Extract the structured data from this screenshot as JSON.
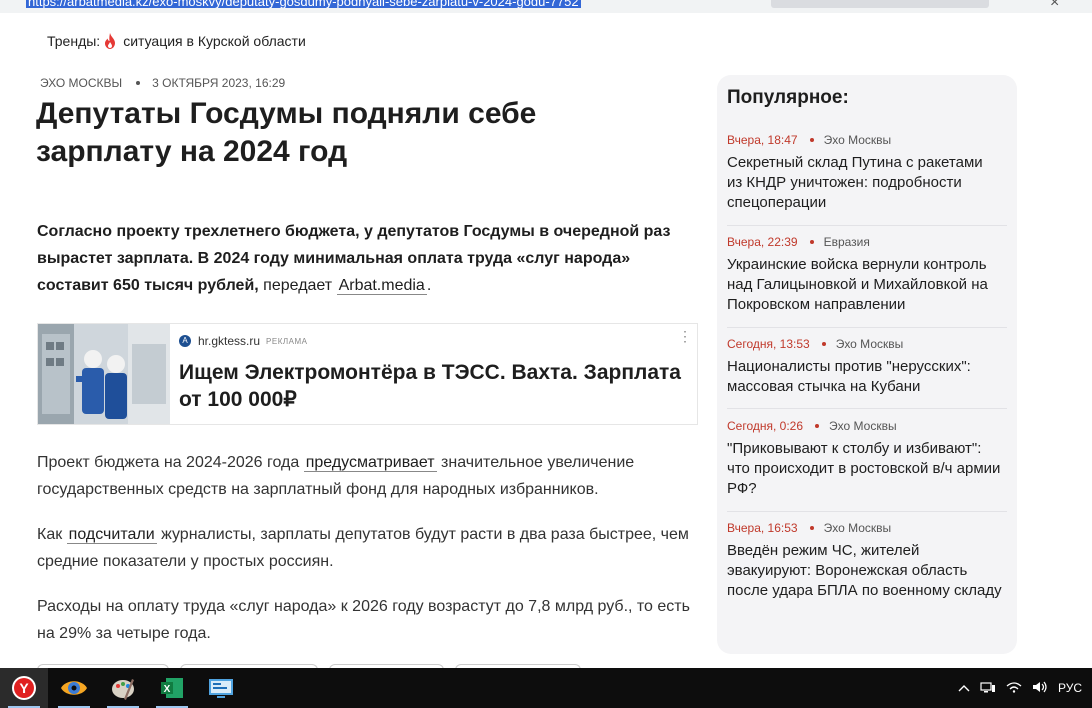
{
  "browser": {
    "url": "https://arbatmedia.kz/exo-moskvy/deputaty-gosdumy-podnyali-sebe-zarplatu-v-2024-godu-7752"
  },
  "trends": {
    "label": "Тренды:",
    "topic": "ситуация в Курской области",
    "icon": "flame-icon"
  },
  "article": {
    "source": "ЭХО МОСКВЫ",
    "date": "3 ОКТЯБРЯ 2023, 16:29",
    "title": "Депутаты Госдумы подняли себе зарплату на 2024 год",
    "lead_bold": "Согласно проекту трехлетнего бюджета, у депутатов Госдумы в очередной раз вырастет зарплата. В 2024 году минимальная оплата труда «слуг народа» составит 650 тысяч рублей,",
    "lead_plain": " передает ",
    "lead_link": "Arbat.media",
    "lead_end": ".",
    "p1_start": "Проект бюджета на 2024-2026 года ",
    "p1_link": "предусматривает",
    "p1_end": " значительное увеличение государственных средств на зарплатный фонд для народных избранников.",
    "p2_start": "Как ",
    "p2_link": "подсчитали",
    "p2_end": " журналисты, зарплаты депутатов будут расти в два раза быстрее, чем средние показатели у простых россиян.",
    "p3": "Расходы на оплату труда «слуг народа» к 2026 году возрастут до 7,8 млрд руб., то есть на 29% за четыре года."
  },
  "ad": {
    "domain": "hr.gktess.ru",
    "tag": "РЕКЛАМА",
    "text": "Ищем Электромонтёра в ТЭСС. Вахта. Зарплата от 100 000₽"
  },
  "sidebar": {
    "title": "Популярное:",
    "items": [
      {
        "time": "Вчера, 18:47",
        "source": "Эхо Москвы",
        "title": "Секретный склад Путина с ракетами из КНДР уничтожен: подробности спецоперации"
      },
      {
        "time": "Вчера, 22:39",
        "source": "Евразия",
        "title": "Украинские войска вернули контроль над Галицыновкой и Михайловкой на Покровском направлении"
      },
      {
        "time": "Сегодня, 13:53",
        "source": "Эхо Москвы",
        "title": "Националисты против \"нерусских\": массовая стычка на Кубани"
      },
      {
        "time": "Сегодня, 0:26",
        "source": "Эхо Москвы",
        "title": "\"Приковывают к столбу и избивают\": что происходит в ростовской в/ч армии РФ?"
      },
      {
        "time": "Вчера, 16:53",
        "source": "Эхо Москвы",
        "title": "Введён режим ЧС, жителей эвакуируют: Воронежская область после удара БПЛА по военному складу"
      }
    ]
  },
  "taskbar": {
    "apps": [
      "yandex-browser-icon",
      "eye-app-icon",
      "paint-palette-icon",
      "excel-icon",
      "monitor-app-icon"
    ],
    "lang": "РУС"
  },
  "colors": {
    "accent_red": "#c0392b",
    "sidebar_bg": "#f4f4f6",
    "url_highlight": "#3367d6"
  }
}
